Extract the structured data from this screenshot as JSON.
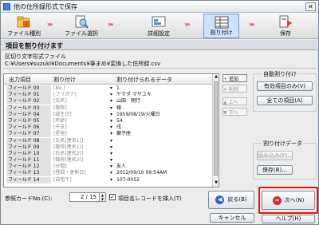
{
  "window": {
    "title": "他の住所録形式で保存",
    "close_glyph": "✕"
  },
  "steps": [
    {
      "label": "ファイル種別",
      "icon": "folder-icon"
    },
    {
      "label": "ファイル選択",
      "icon": "file-search-icon"
    },
    {
      "label": "詳細設定",
      "icon": "settings-icon"
    },
    {
      "label": "割り付け",
      "icon": "grid-icon"
    },
    {
      "label": "保存",
      "icon": "save-icon"
    }
  ],
  "step_arrow": "»»",
  "header": {
    "title": "項目を割り付けます"
  },
  "file": {
    "label": "区切り文字形式ファイル",
    "path": "C:¥Users¥suzuki¥Documents¥筆まめ¥変換した住所録.csv"
  },
  "table": {
    "headers": [
      "出力項目",
      "割り付け",
      "割り付けられるデータ"
    ],
    "rows": [
      [
        "フィールド 00",
        "[No.]",
        "1"
      ],
      [
        "フィールド 01",
        "[フリガナ]",
        "ヤマダ マサユキ"
      ],
      [
        "フィールド 02",
        "[氏名]",
        "山田　翔行"
      ],
      [
        "フィールド 03",
        "[敬称]",
        "様"
      ],
      [
        "フィールド 04",
        "[誕生日]",
        "1959/08/19/火曜日"
      ],
      [
        "フィールド 05",
        "[年齢]",
        "54"
      ],
      [
        "フィールド 06",
        "[干支]",
        "戌"
      ],
      [
        "フィールド 07",
        "[星座]",
        "獅子座"
      ],
      [
        "フィールド 08",
        "[氏名(連名1)]",
        ""
      ],
      [
        "フィールド 09",
        "[敬称(連名1)]",
        ""
      ],
      [
        "フィールド 10",
        "[氏名(連名2)]",
        ""
      ],
      [
        "フィールド 11",
        "[敬称(連名2)]",
        ""
      ],
      [
        "フィールド 12",
        "[分類]",
        "友人"
      ],
      [
        "フィールド 13",
        "[登録・更新日]",
        "2012/09/10 09:54AM"
      ],
      [
        "フィールド 14",
        "[自宅〒]",
        "107-0052"
      ]
    ]
  },
  "side_buttons": {
    "add": "追加",
    "delete": "削除",
    "up": "上へ",
    "down": "下へ"
  },
  "auto_group": {
    "title": "自動割り付け",
    "valid_items": "有効項目のみ(V)",
    "all_items": "全ての項目(A)"
  },
  "data_group": {
    "title": "割り付けデータ",
    "load": "読み込み(F)...",
    "save": "保存(B)..."
  },
  "bottom": {
    "ref_card_label": "参照カードNo.(C):",
    "ref_card_value": "2 / 15",
    "checkbox_checked": true,
    "checkbox_label": "項目名レコードを挿入(T)",
    "back": "戻る(B)",
    "next": "次へ(N)",
    "cancel": "キャンセル",
    "help": "ヘルプ(H)"
  },
  "colors": {
    "highlight": "#e11111",
    "active_step": "#cde2fa",
    "back_icon": "#2a66c9",
    "next_icon": "#d8282d"
  }
}
